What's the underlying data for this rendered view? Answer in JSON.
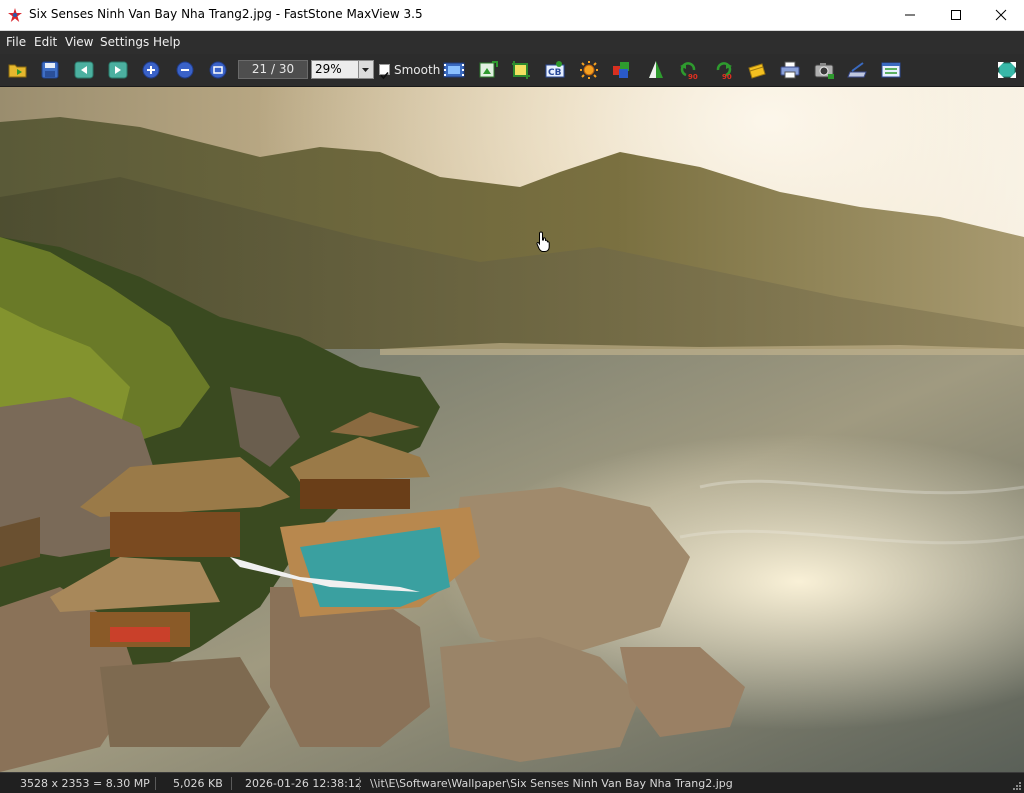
{
  "window": {
    "title": "Six Senses Ninh Van Bay Nha Trang2.jpg - FastStone MaxView 3.5",
    "icon": "app-logo-icon"
  },
  "menu": {
    "items": [
      {
        "label": "File"
      },
      {
        "label": "Edit"
      },
      {
        "label": "View"
      },
      {
        "label": "Settings"
      },
      {
        "label": "Help"
      }
    ]
  },
  "toolbar": {
    "icons": [
      "open-folder-icon",
      "save-icon",
      "previous-icon",
      "next-icon",
      "zoom-in-icon",
      "zoom-out-icon",
      "actual-size-icon",
      "slideshow-icon",
      "resize-icon",
      "crop-icon",
      "color-adjust-icon",
      "brightness-icon",
      "colors-icon",
      "sharpen-icon",
      "rotate-left-icon",
      "rotate-right-icon",
      "wallpaper-icon",
      "print-icon",
      "capture-icon",
      "scan-icon",
      "settings-panel-icon",
      "fullscreen-icon"
    ],
    "page_counter": "21 / 30",
    "zoom_value": "29%",
    "smooth_label": "Smooth",
    "smooth_checked": true
  },
  "status": {
    "dimensions": "3528 x 2353 = 8.30 MP",
    "file_size": "5,026 KB",
    "datetime": "2026-01-26 12:38:12",
    "path": "\\\\it\\E\\Software\\Wallpaper\\Six Senses Ninh Van Bay Nha Trang2.jpg"
  },
  "colors": {
    "menubar": "#2e2e2e",
    "toolbar": "#2c2c2c",
    "statusbar": "#202020",
    "text_light": "#f0f0f0"
  }
}
